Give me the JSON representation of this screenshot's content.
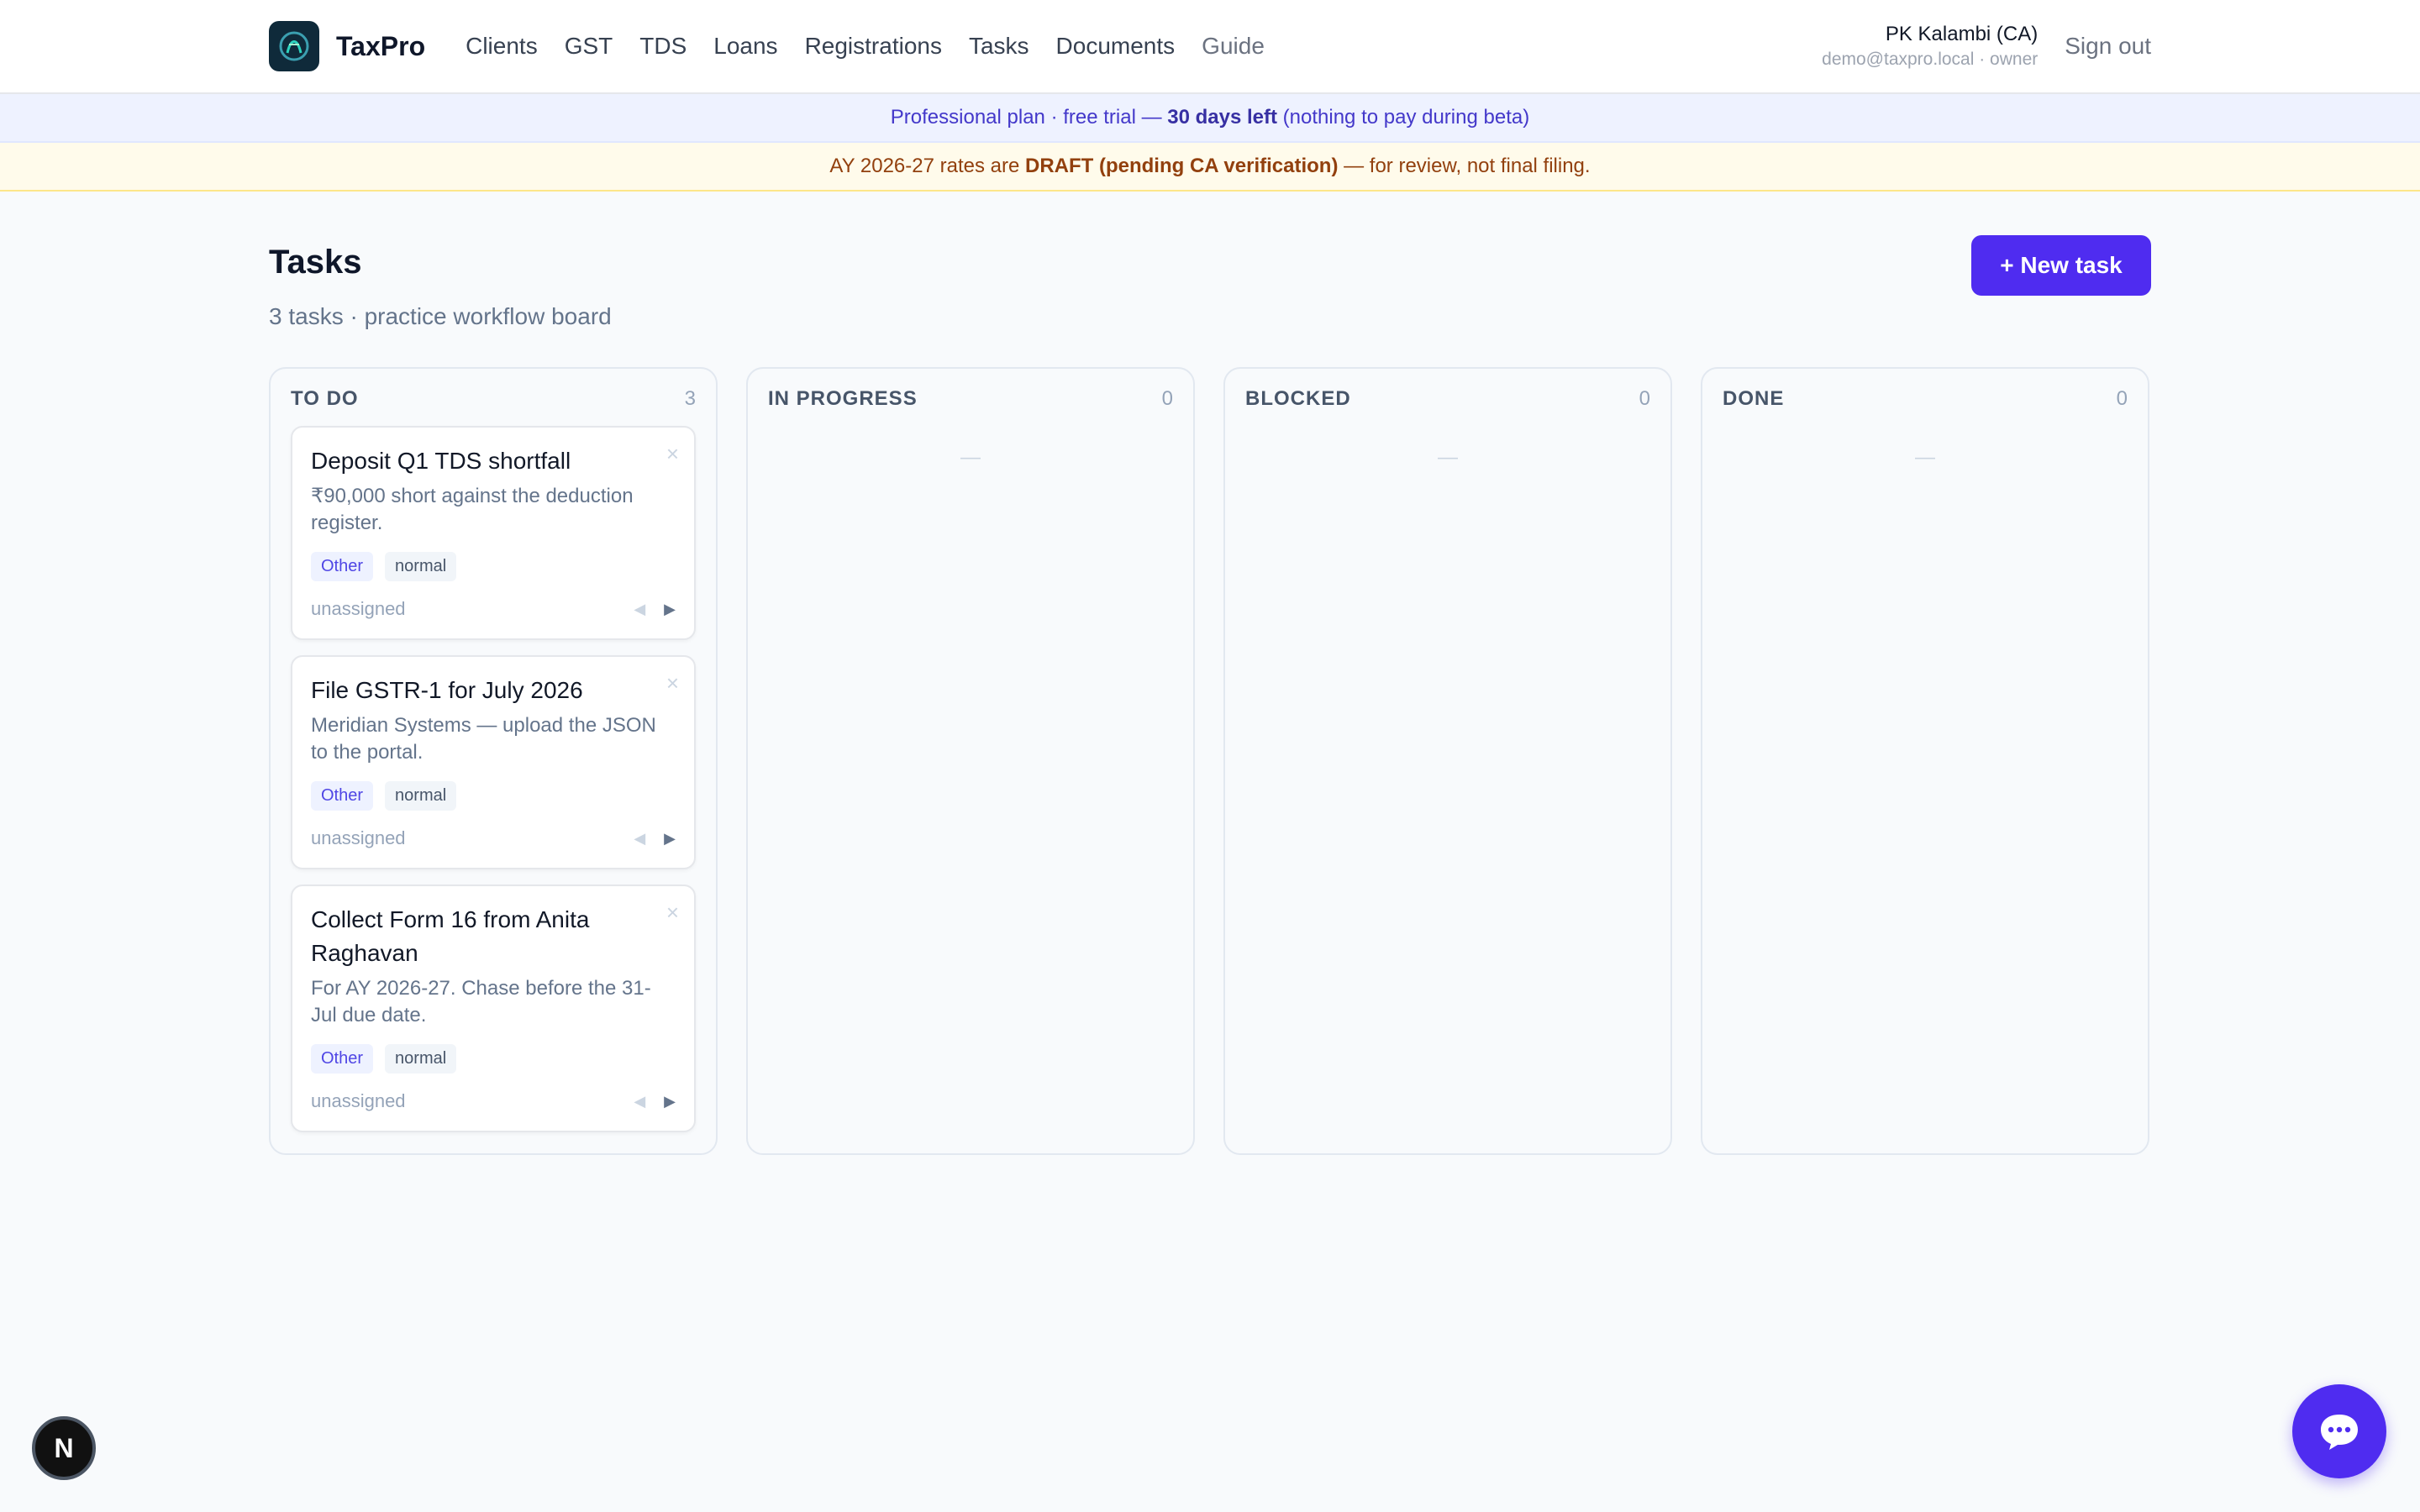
{
  "brand": {
    "name": "TaxPro"
  },
  "nav": {
    "items": [
      {
        "label": "Clients"
      },
      {
        "label": "GST"
      },
      {
        "label": "TDS"
      },
      {
        "label": "Loans"
      },
      {
        "label": "Registrations"
      },
      {
        "label": "Tasks"
      },
      {
        "label": "Documents"
      },
      {
        "label": "Guide"
      }
    ]
  },
  "user": {
    "name": "PK Kalambi (CA)",
    "sub": "demo@taxpro.local · owner",
    "signout": "Sign out"
  },
  "plan_banner": {
    "prefix": "Professional plan · free trial — ",
    "strong": "30 days left",
    "suffix": " (nothing to pay during beta)"
  },
  "draft_banner": {
    "prefix": "AY 2026-27 rates are ",
    "strong": "DRAFT (pending CA verification)",
    "suffix": " — for review, not final filing."
  },
  "page": {
    "title": "Tasks",
    "subtitle": "3 tasks · practice workflow board",
    "new_button": "+ New task"
  },
  "columns": [
    {
      "title": "TO DO",
      "count": "3",
      "empty": "—"
    },
    {
      "title": "IN PROGRESS",
      "count": "0",
      "empty": "—"
    },
    {
      "title": "BLOCKED",
      "count": "0",
      "empty": "—"
    },
    {
      "title": "DONE",
      "count": "0",
      "empty": "—"
    }
  ],
  "tasks": [
    {
      "title": "Deposit Q1 TDS shortfall",
      "desc": "₹90,000 short against the deduction register.",
      "type": "Other",
      "priority": "normal",
      "assignee": "unassigned",
      "close": "×",
      "prev": "◀",
      "next": "▶"
    },
    {
      "title": "File GSTR-1 for July 2026",
      "desc": "Meridian Systems — upload the JSON to the portal.",
      "type": "Other",
      "priority": "normal",
      "assignee": "unassigned",
      "close": "×",
      "prev": "◀",
      "next": "▶"
    },
    {
      "title": "Collect Form 16 from Anita Raghavan",
      "desc": "For AY 2026-27. Chase before the 31-Jul due date.",
      "type": "Other",
      "priority": "normal",
      "assignee": "unassigned",
      "close": "×",
      "prev": "◀",
      "next": "▶"
    }
  ],
  "dev_badge": {
    "letter": "N"
  },
  "icons": {
    "chat": "chat-bubble-icon",
    "logo": "taxpro-logo-icon"
  },
  "colors": {
    "accent": "#4f2cf0",
    "plan_text": "#4338ca",
    "draft_text": "#92400e"
  }
}
